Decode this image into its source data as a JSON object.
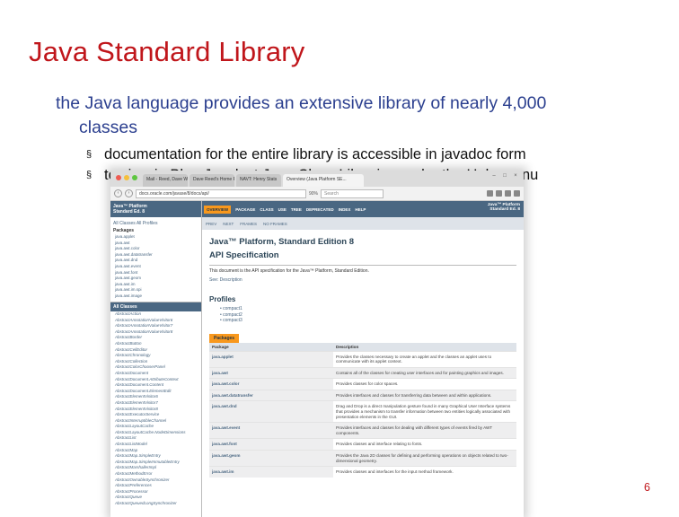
{
  "slide": {
    "title": "Java Standard Library",
    "bullet_l1": "the Java language provides an extensive library of nearly 4,000",
    "bullet_l1_cont": "classes",
    "bullet_marker": "§",
    "bullets_l2": [
      "documentation for the entire library is accessible in javadoc form",
      "to view in Blue J, select Java Class Libraries under the Help menu"
    ],
    "page_number": "6"
  },
  "browser": {
    "tabs": [
      "Mail - Reed, Dave W - Outl...",
      "Dave Reed's Home Page",
      "NAVT: Henry Stats",
      "Overview (Java Platform SE..."
    ],
    "url": "docs.oracle.com/javase/8/docs/api/",
    "zoom": "90%",
    "search_placeholder": "Search",
    "colors": {
      "nav": "#4a6782",
      "accent": "#f8981d",
      "title": "#2c4557"
    }
  },
  "javadoc": {
    "left_header": "Java™ Platform\nStandard Ed. 8",
    "left_links": "All Classes   All Profiles",
    "packages_label": "Packages",
    "packages": [
      "java.applet",
      "java.awt",
      "java.awt.color",
      "java.awt.datatransfer",
      "java.awt.dnd",
      "java.awt.event",
      "java.awt.font",
      "java.awt.geom",
      "java.awt.im",
      "java.awt.im.spi",
      "java.awt.image"
    ],
    "all_classes_label": "All Classes",
    "classes": [
      "AbstractAction",
      "AbstractAnnotationValueVisitor6",
      "AbstractAnnotationValueVisitor7",
      "AbstractAnnotationValueVisitor8",
      "AbstractBorder",
      "AbstractButton",
      "AbstractCellEditor",
      "AbstractChronology",
      "AbstractCollection",
      "AbstractColorChooserPanel",
      "AbstractDocument",
      "AbstractDocument.AttributeContext",
      "AbstractDocument.Content",
      "AbstractDocument.ElementEdit",
      "AbstractElementVisitor6",
      "AbstractElementVisitor7",
      "AbstractElementVisitor8",
      "AbstractExecutorService",
      "AbstractInterruptibleChannel",
      "AbstractLayoutCache",
      "AbstractLayoutCache.NodeDimensions",
      "AbstractList",
      "AbstractListModel",
      "AbstractMap",
      "AbstractMap.SimpleEntry",
      "AbstractMap.SimpleImmutableEntry",
      "AbstractMarshallerImpl",
      "AbstractMethodError",
      "AbstractOwnableSynchronizer",
      "AbstractPreferences",
      "AbstractProcessor",
      "AbstractQueue",
      "AbstractQueuedLongSynchronizer"
    ],
    "nav_items": [
      "OVERVIEW",
      "PACKAGE",
      "CLASS",
      "USE",
      "TREE",
      "DEPRECATED",
      "INDEX",
      "HELP"
    ],
    "brand": "Java™ Platform\nStandard Ed. 8",
    "sub_nav": [
      "PREV",
      "NEXT",
      "FRAMES",
      "NO FRAMES"
    ],
    "doc_title_1": "Java™ Platform, Standard Edition 8",
    "doc_title_2": "API Specification",
    "intro": "This document is the API specification for the Java™ Platform, Standard Edition.",
    "see_desc": "See: Description",
    "profiles_heading": "Profiles",
    "profiles": [
      "compact1",
      "compact2",
      "compact3"
    ],
    "packages_tab": "Packages",
    "table_headers": [
      "Package",
      "Description"
    ],
    "rows": [
      {
        "name": "java.applet",
        "desc": "Provides the classes necessary to create an applet and the classes an applet uses to communicate with its applet context."
      },
      {
        "name": "java.awt",
        "desc": "Contains all of the classes for creating user interfaces and for painting graphics and images."
      },
      {
        "name": "java.awt.color",
        "desc": "Provides classes for color spaces."
      },
      {
        "name": "java.awt.datatransfer",
        "desc": "Provides interfaces and classes for transferring data between and within applications."
      },
      {
        "name": "java.awt.dnd",
        "desc": "Drag and Drop is a direct manipulation gesture found in many Graphical User Interface systems that provides a mechanism to transfer information between two entities logically associated with presentation elements in the GUI."
      },
      {
        "name": "java.awt.event",
        "desc": "Provides interfaces and classes for dealing with different types of events fired by AWT components."
      },
      {
        "name": "java.awt.font",
        "desc": "Provides classes and interface relating to fonts."
      },
      {
        "name": "java.awt.geom",
        "desc": "Provides the Java 2D classes for defining and performing operations on objects related to two-dimensional geometry."
      },
      {
        "name": "java.awt.im",
        "desc": "Provides classes and interfaces for the input method framework."
      }
    ]
  }
}
